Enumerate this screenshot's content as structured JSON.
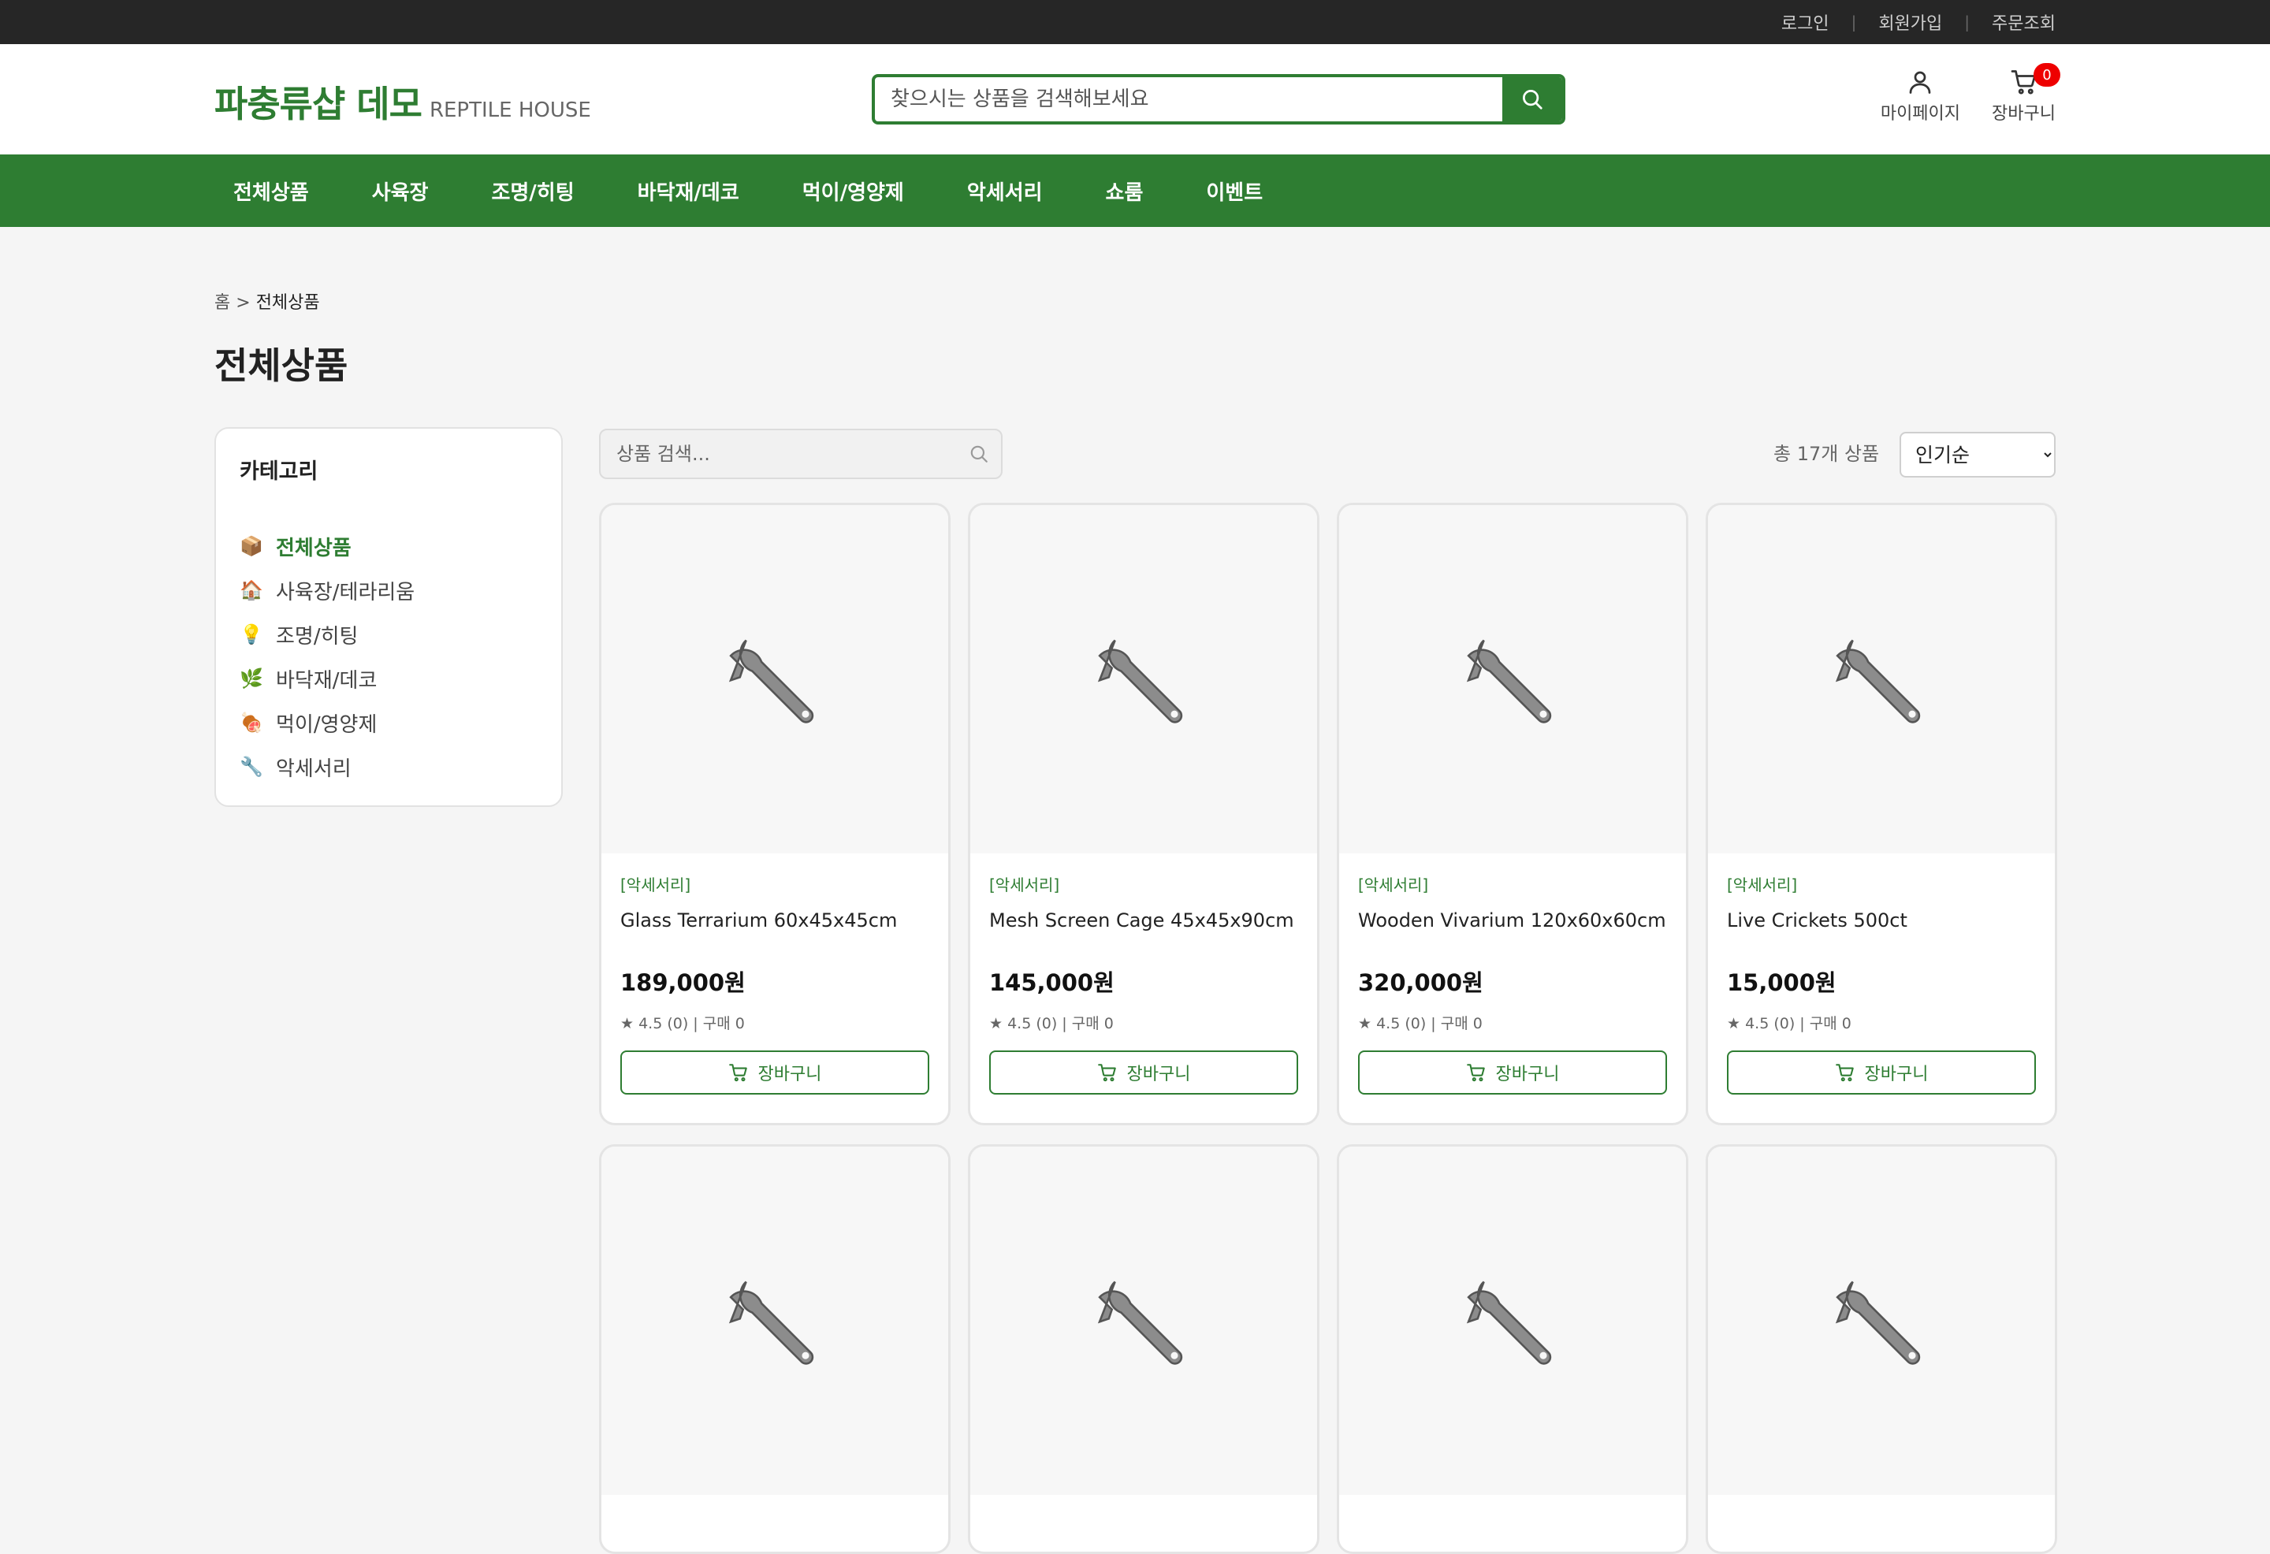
{
  "topbar": {
    "links": [
      "로그인",
      "회원가입",
      "주문조회"
    ]
  },
  "header": {
    "logo_main": "파충류샵 데모",
    "logo_sub": "REPTILE HOUSE",
    "search_placeholder": "찾으시는 상품을 검색해보세요",
    "mypage_label": "마이페이지",
    "cart_label": "장바구니",
    "cart_count": "0"
  },
  "nav": {
    "items": [
      "전체상품",
      "사육장",
      "조명/히팅",
      "바닥재/데코",
      "먹이/영양제",
      "악세서리",
      "쇼룸",
      "이벤트"
    ]
  },
  "breadcrumb": {
    "home": "홈",
    "sep": ">",
    "current": "전체상품"
  },
  "page_title": "전체상품",
  "sidebar": {
    "title": "카테고리",
    "categories": [
      {
        "icon": "box-icon",
        "glyph": "📦",
        "label": "전체상품",
        "active": true
      },
      {
        "icon": "house-icon",
        "glyph": "🏠",
        "label": "사육장/테라리움"
      },
      {
        "icon": "bulb-icon",
        "glyph": "💡",
        "label": "조명/히팅"
      },
      {
        "icon": "herb-icon",
        "glyph": "🌿",
        "label": "바닥재/데코"
      },
      {
        "icon": "meat-icon",
        "glyph": "🍖",
        "label": "먹이/영양제"
      },
      {
        "icon": "wrench-icon",
        "glyph": "🔧",
        "label": "악세서리"
      }
    ]
  },
  "toolbar": {
    "search_placeholder": "상품 검색...",
    "total_text": "총 17개 상품",
    "sort_selected": "인기순"
  },
  "products": [
    {
      "category": "[악세서리]",
      "name": "Glass Terrarium 60x45x45cm",
      "price": "189,000원",
      "meta": "★ 4.5 (0) | 구매 0",
      "cart_label": "장바구니"
    },
    {
      "category": "[악세서리]",
      "name": "Mesh Screen Cage 45x45x90cm",
      "price": "145,000원",
      "meta": "★ 4.5 (0) | 구매 0",
      "cart_label": "장바구니"
    },
    {
      "category": "[악세서리]",
      "name": "Wooden Vivarium 120x60x60cm",
      "price": "320,000원",
      "meta": "★ 4.5 (0) | 구매 0",
      "cart_label": "장바구니"
    },
    {
      "category": "[악세서리]",
      "name": "Live Crickets 500ct",
      "price": "15,000원",
      "meta": "★ 4.5 (0) | 구매 0",
      "cart_label": "장바구니"
    },
    {
      "category": "",
      "name": "",
      "price": "",
      "meta": "",
      "cart_label": ""
    },
    {
      "category": "",
      "name": "",
      "price": "",
      "meta": "",
      "cart_label": ""
    },
    {
      "category": "",
      "name": "",
      "price": "",
      "meta": "",
      "cart_label": ""
    },
    {
      "category": "",
      "name": "",
      "price": "",
      "meta": "",
      "cart_label": ""
    }
  ],
  "colors": {
    "brand": "#2e7d32",
    "topbar": "#262626",
    "badge": "#ee0000"
  }
}
